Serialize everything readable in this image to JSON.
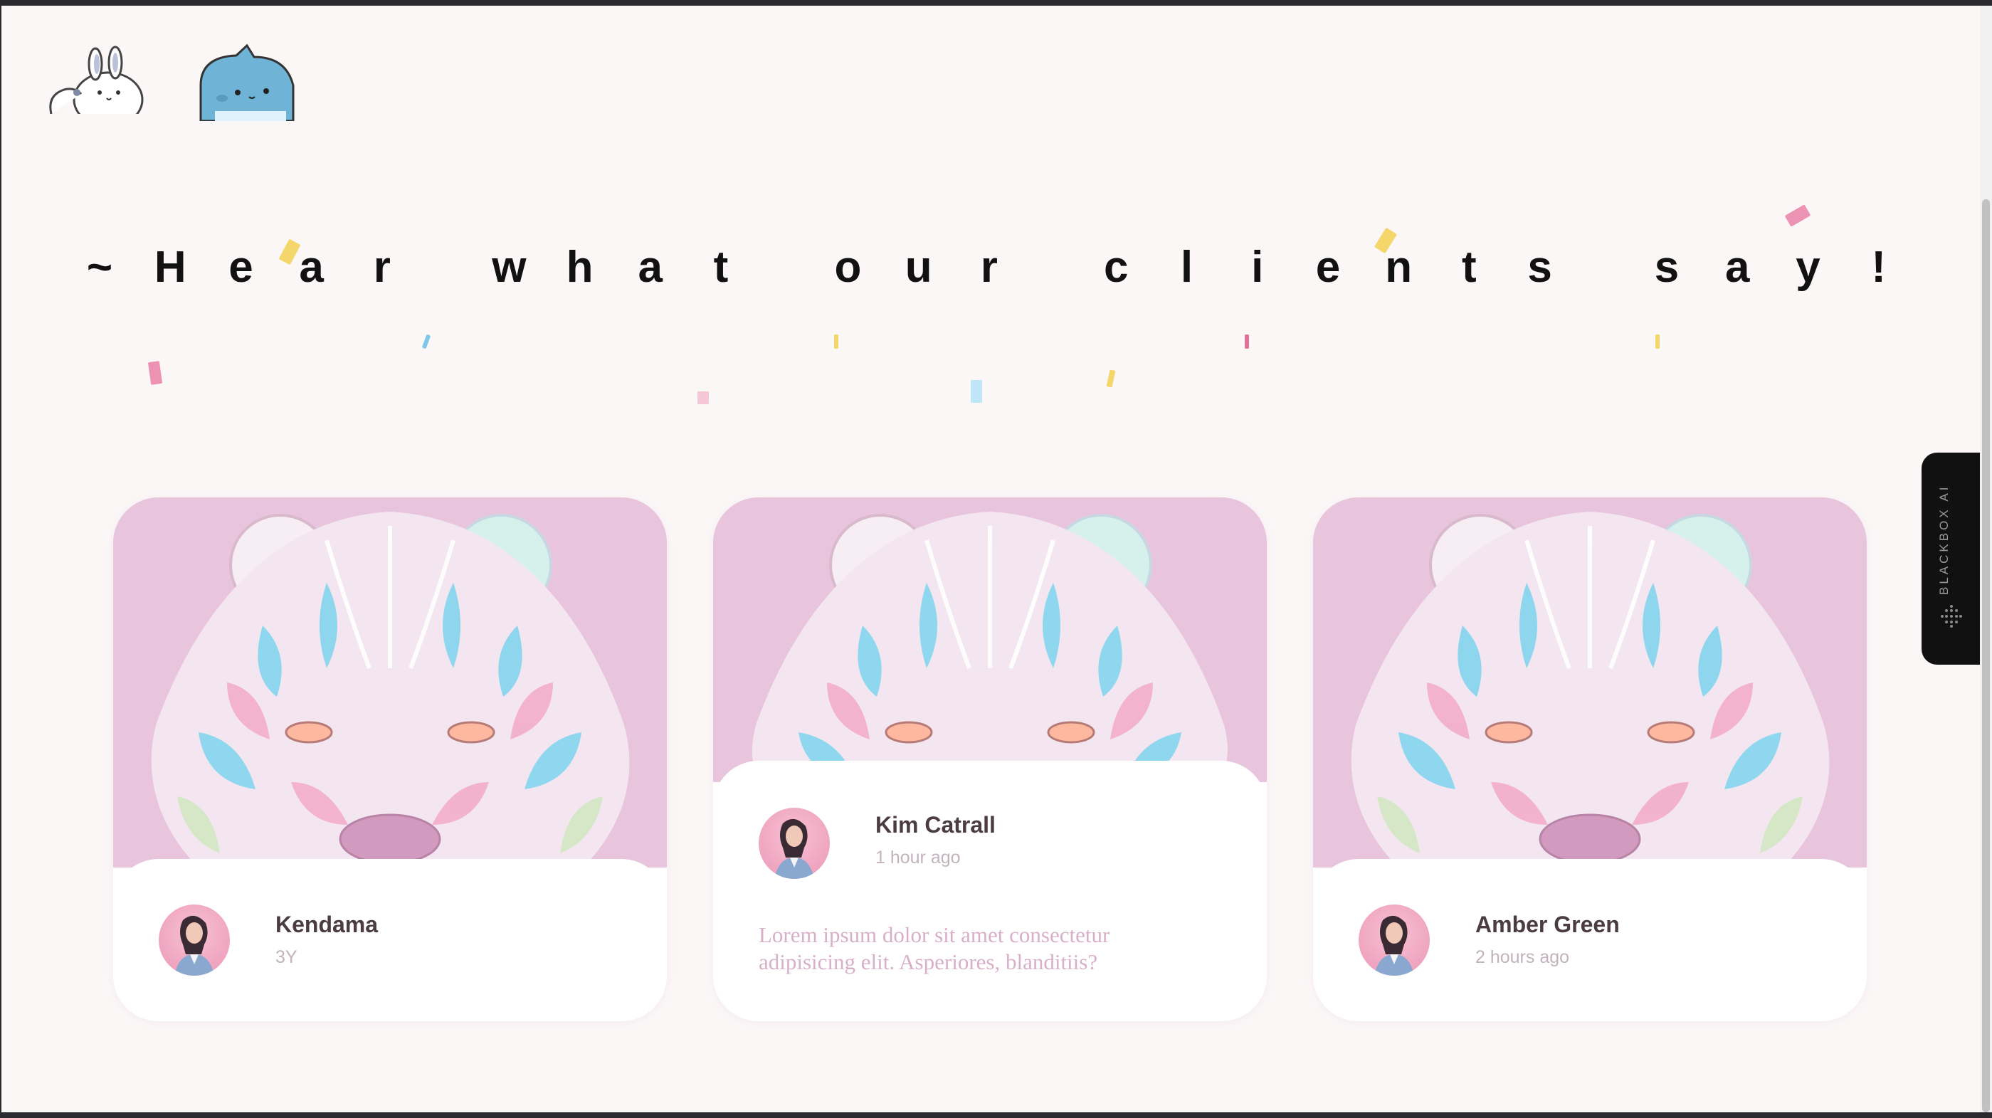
{
  "heading": {
    "letters": [
      "~",
      "H",
      "e",
      "a",
      "r",
      " ",
      "w",
      "h",
      "a",
      "t",
      " ",
      "o",
      "u",
      "r",
      " ",
      "c",
      "l",
      "i",
      "e",
      "n",
      "t",
      "s",
      " ",
      "s",
      "a",
      "y",
      "!"
    ]
  },
  "cards": [
    {
      "name": "Kendama",
      "time": "3Y",
      "quote": ""
    },
    {
      "name": "Kim Catrall",
      "time": "1 hour ago",
      "quote": "Lorem ipsum dolor sit amet consectetur adipisicing elit. Asperiores, blanditiis?"
    },
    {
      "name": "Amber Green",
      "time": "2 hours ago",
      "quote": ""
    }
  ],
  "sidebar_widget": {
    "label": "BLACKBOX AI"
  },
  "colors": {
    "background": "#fbf7f7",
    "card_art_bg": "#e9c2dc",
    "name_text": "#4b3b42",
    "time_text": "#c3b3bd",
    "quote_text": "#d7b0c8"
  }
}
